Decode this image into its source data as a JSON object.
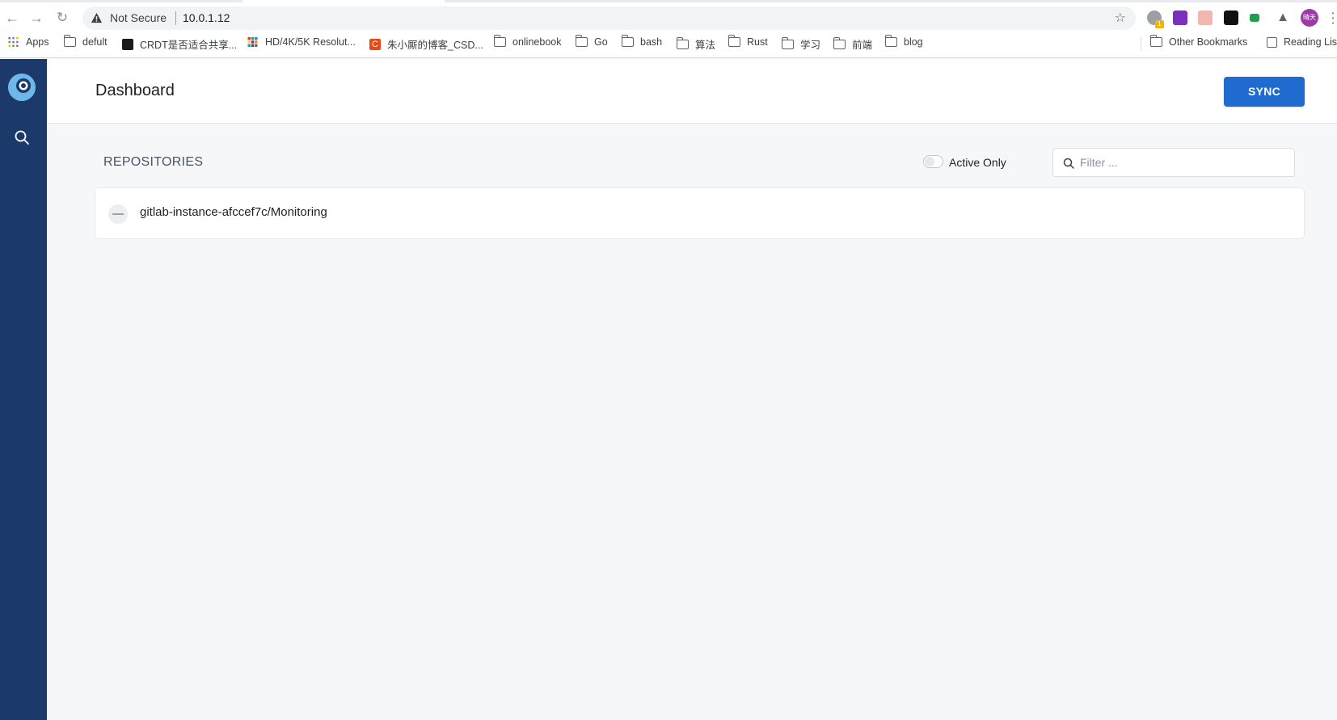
{
  "browser": {
    "security_label": "Not Secure",
    "url": "10.0.1.12",
    "bookmarks": [
      {
        "label": "Apps",
        "icon": "apps-grid-icon"
      },
      {
        "label": "defult",
        "icon": "folder-icon"
      },
      {
        "label": "CRDT是否适合共享...",
        "icon": "site-icon"
      },
      {
        "label": "HD/4K/5K Resolut...",
        "icon": "site-icon"
      },
      {
        "label": "朱小厮的博客_CSD...",
        "icon": "csdn-icon"
      },
      {
        "label": "onlinebook",
        "icon": "folder-icon"
      },
      {
        "label": "Go",
        "icon": "folder-icon"
      },
      {
        "label": "bash",
        "icon": "folder-icon"
      },
      {
        "label": "算法",
        "icon": "folder-icon"
      },
      {
        "label": "Rust",
        "icon": "folder-icon"
      },
      {
        "label": "学习",
        "icon": "folder-icon"
      },
      {
        "label": "前端",
        "icon": "folder-icon"
      },
      {
        "label": "blog",
        "icon": "folder-icon"
      }
    ],
    "other_bookmarks": "Other Bookmarks",
    "reading_list": "Reading Lis",
    "extension_badge": "1",
    "profile_initials": "晴天"
  },
  "app": {
    "page_title": "Dashboard",
    "sync_label": "SYNC",
    "section_title": "REPOSITORIES",
    "active_only_label": "Active Only",
    "active_only": false,
    "filter_placeholder": "Filter ...",
    "repos": [
      {
        "name": "gitlab-instance-afccef7c/Monitoring",
        "status": "inactive"
      }
    ]
  },
  "colors": {
    "sidebar": "#1b3a6b",
    "accent": "#1f6bd0",
    "background": "#f5f7f9"
  }
}
